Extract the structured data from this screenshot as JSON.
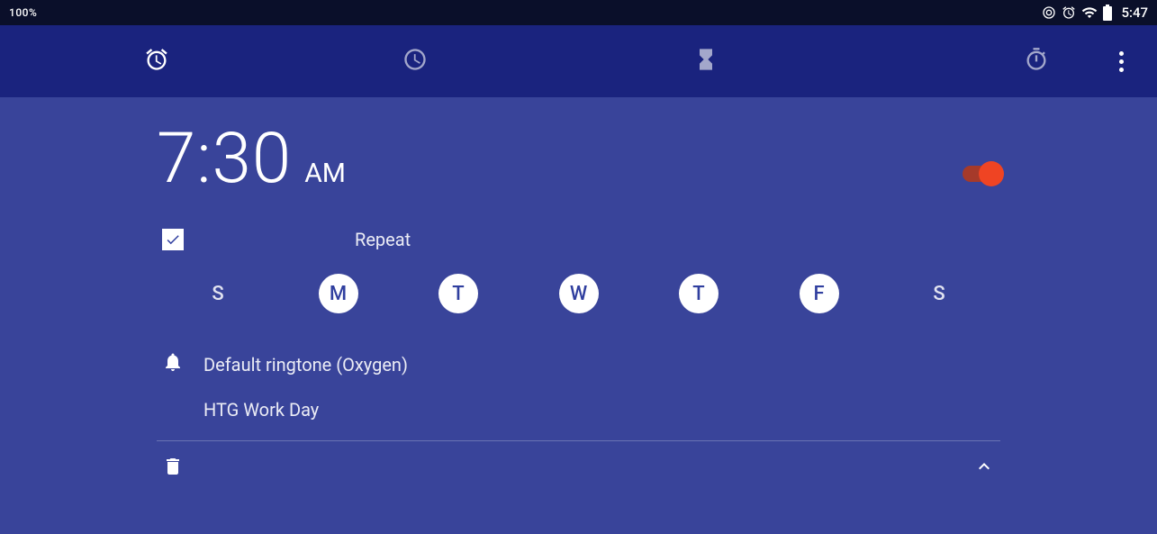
{
  "status": {
    "battery_pct": "100%",
    "time": "5:47"
  },
  "tabs": {
    "active_index": 0
  },
  "alarm": {
    "time": "7:30",
    "ampm": "AM",
    "enabled": true,
    "repeat_label": "Repeat",
    "repeat_checked": true,
    "days": [
      {
        "letter": "S",
        "on": false
      },
      {
        "letter": "M",
        "on": true
      },
      {
        "letter": "T",
        "on": true
      },
      {
        "letter": "W",
        "on": true
      },
      {
        "letter": "T",
        "on": true
      },
      {
        "letter": "F",
        "on": true
      },
      {
        "letter": "S",
        "on": false
      }
    ],
    "ringtone": "Default ringtone (Oxygen)",
    "label": "HTG Work Day"
  }
}
